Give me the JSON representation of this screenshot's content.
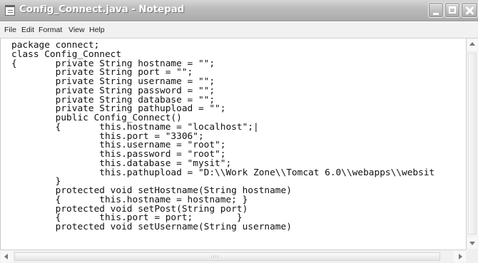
{
  "window": {
    "title": "Config_Connect.java - Notepad",
    "app_icon": "notepad-icon",
    "controls": {
      "minimize_icon": "minimize-icon",
      "maximize_icon": "maximize-icon",
      "close_icon": "close-icon"
    }
  },
  "menu": {
    "file": "File",
    "edit": "Edit",
    "format": "Format",
    "view": "View",
    "help": "Help"
  },
  "editor": {
    "text": "package connect;\nclass Config_Connect\n{       private String hostname = \"\";\n        private String port = \"\";\n        private String username = \"\";\n        private String password = \"\";\n        private String database = \"\";\n        private String pathupload = \"\";\n        public Config_Connect()\n        {       this.hostname = \"localhost\";|\n                this.port = \"3306\";\n                this.username = \"root\";\n                this.password = \"root\";\n                this.database = \"mysit\";\n                this.pathupload = \"D:\\\\Work Zone\\\\Tomcat 6.0\\\\webapps\\\\websit\n        }\n        protected void setHostname(String hostname)\n        {       this.hostname = hostname; }\n        protected void setPost(String port)\n        {       this.port = port;        }\n        protected void setUsername(String username)"
  },
  "scrollbars": {
    "up_icon": "scroll-up-icon",
    "down_icon": "scroll-down-icon",
    "left_icon": "scroll-left-icon",
    "right_icon": "scroll-right-icon"
  },
  "colors": {
    "title_bar": "#b8b8b8",
    "menu_bar": "#f1f1f1",
    "editor_background": "#ffffff",
    "text": "#111111"
  }
}
